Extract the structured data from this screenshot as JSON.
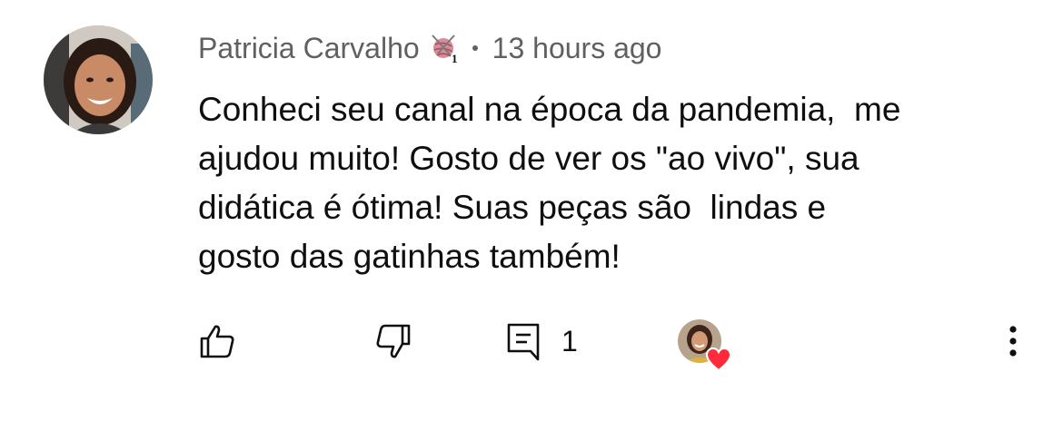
{
  "comment": {
    "author": "Patricia Carvalho",
    "badge_icon": "yarn-ball-member-badge-icon",
    "badge_number": "1",
    "timestamp": "13 hours ago",
    "text": "Conheci seu canal na época da pandemia,  me\najudou muito! Gosto de ver os \"ao vivo\", sua\ndidática é ótima! Suas peças são  lindas e\ngosto das gatinhas também!"
  },
  "actions": {
    "like_icon": "thumbs-up-icon",
    "dislike_icon": "thumbs-down-icon",
    "reply_icon": "comment-reply-icon",
    "reply_count": "1",
    "creator_heart_icon": "heart-icon",
    "more_icon": "more-vertical-icon"
  },
  "colors": {
    "meta_text": "#606060",
    "body_text": "#0f0f0f",
    "heart": "#ff0033"
  }
}
